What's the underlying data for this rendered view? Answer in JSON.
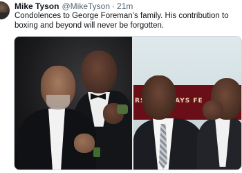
{
  "tweet": {
    "author_name": "Mike Tyson",
    "handle": "@MikeTyson",
    "separator": "·",
    "time": "21m",
    "text": "Condolences to George Foreman’s family. His contribution to boxing and beyond will never be forgotten.",
    "avatar_icon": "profile-avatar",
    "media": {
      "photo_count": 2,
      "photos": [
        {
          "name": "left-photo"
        },
        {
          "name": "right-photo",
          "banner_text": "RS TUESDAYS FE"
        }
      ]
    }
  },
  "colors": {
    "text_primary": "#0f1419",
    "text_secondary": "#536471",
    "media_border": "#cfd9de",
    "background": "#ffffff"
  }
}
